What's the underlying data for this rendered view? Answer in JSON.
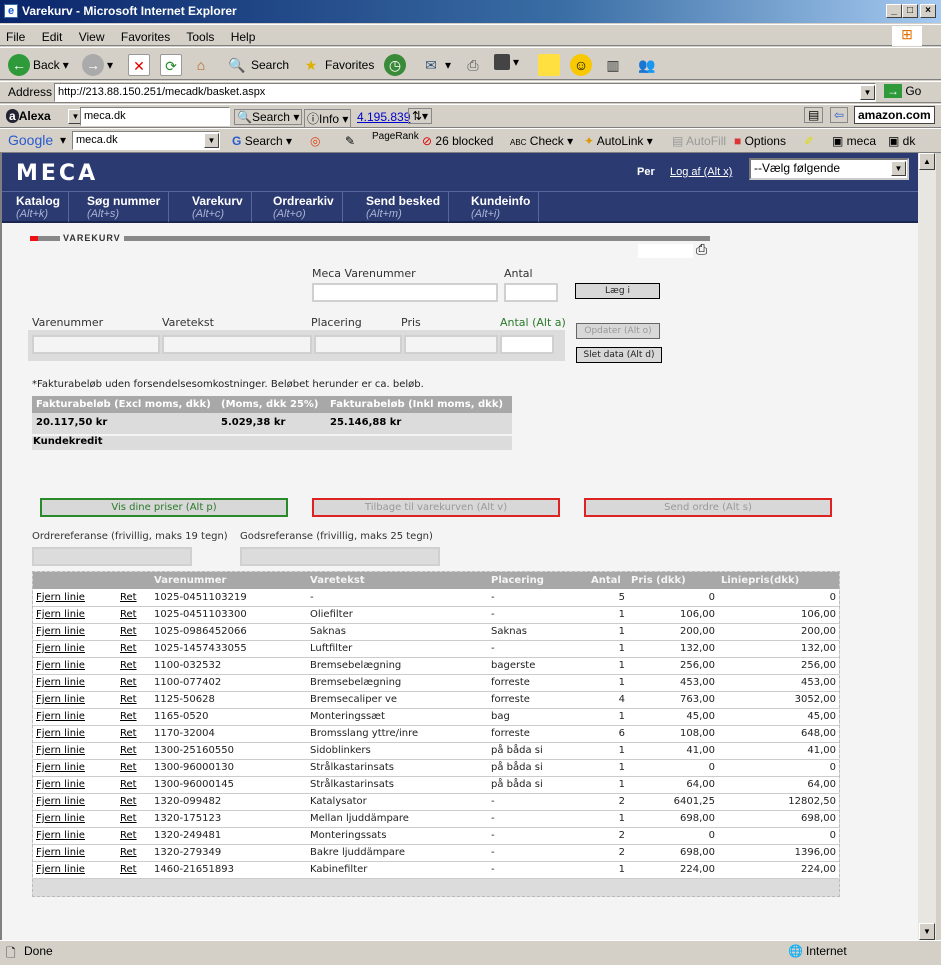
{
  "window": {
    "title": "Varekurv - Microsoft Internet Explorer"
  },
  "menu": [
    "File",
    "Edit",
    "View",
    "Favorites",
    "Tools",
    "Help"
  ],
  "toolbar": {
    "back": "Back",
    "search": "Search",
    "favorites": "Favorites"
  },
  "address": {
    "label": "Address",
    "url": "http://213.88.150.251/mecadk/basket.aspx",
    "go": "Go"
  },
  "alexa": {
    "brand": "Alexa",
    "query": "meca.dk",
    "search": "Search",
    "info": "Info",
    "rank": "4.195.839",
    "amazon": "amazon.com"
  },
  "google": {
    "brand": "Google",
    "query": "meca.dk",
    "search": "Search",
    "pagerank": "PageRank",
    "blocked": "26 blocked",
    "check": "Check",
    "autolink": "AutoLink",
    "autofill": "AutoFill",
    "options": "Options",
    "meca": "meca",
    "dk": "dk"
  },
  "header": {
    "logo": "MECA",
    "user": "Per",
    "logout": "Log af (Alt x)",
    "select": "--Vælg følgende"
  },
  "nav": [
    {
      "label": "Katalog",
      "key": "(Alt+k)"
    },
    {
      "label": "Søg nummer",
      "key": "(Alt+s)"
    },
    {
      "label": "Varekurv",
      "key": "(Alt+c)"
    },
    {
      "label": "Ordrearkiv",
      "key": "(Alt+o)"
    },
    {
      "label": "Send besked",
      "key": "(Alt+m)"
    },
    {
      "label": "Kundeinfo",
      "key": "(Alt+i)"
    }
  ],
  "section_title": "VAREKURV",
  "add": {
    "meca_varenummer": "Meca Varenummer",
    "antal": "Antal",
    "button": "Læg i"
  },
  "edit": {
    "varenummer": "Varenummer",
    "varetekst": "Varetekst",
    "placering": "Placering",
    "pris": "Pris",
    "antal": "Antal (Alt a)",
    "update": "Opdater (Alt o)",
    "delete": "Slet data (Alt d)"
  },
  "summary": {
    "note": "*Fakturabeløb uden forsendelsesomkostninger. Beløbet herunder er ca. beløb.",
    "headers": [
      "Fakturabeløb (Excl moms, dkk)",
      "(Moms, dkk 25%)",
      "Fakturabeløb (Inkl moms, dkk)"
    ],
    "values": [
      "20.117,50 kr",
      "5.029,38 kr",
      "25.146,88 kr"
    ],
    "credit": "Kundekredit"
  },
  "actions": {
    "prices": "Vis dine priser (Alt p)",
    "back": "Tilbage til varekurven  (Alt v)",
    "send": "Send ordre (Alt s)"
  },
  "refs": {
    "order": "Ordrereferanse (frivillig, maks 19 tegn)",
    "goods": "Godsreferanse (frivillig, maks 25 tegn)"
  },
  "cart": {
    "headers": [
      "",
      "",
      "Varenummer",
      "Varetekst",
      "Placering",
      "Antal",
      "Pris (dkk)",
      "Liniepris(dkk)"
    ],
    "remove": "Fjern linie",
    "edit": "Ret",
    "rows": [
      [
        "1025-0451103219",
        "-",
        "-",
        "5",
        "0",
        "0"
      ],
      [
        "1025-0451103300",
        "Oliefilter",
        "-",
        "1",
        "106,00",
        "106,00"
      ],
      [
        "1025-0986452066",
        "Saknas",
        "Saknas",
        "1",
        "200,00",
        "200,00"
      ],
      [
        "1025-1457433055",
        "Luftfilter",
        "-",
        "1",
        "132,00",
        "132,00"
      ],
      [
        "1100-032532",
        "Bremsebelægning",
        "bagerste",
        "1",
        "256,00",
        "256,00"
      ],
      [
        "1100-077402",
        "Bremsebelægning",
        "forreste",
        "1",
        "453,00",
        "453,00"
      ],
      [
        "1125-50628",
        "Bremsecaliper ve",
        "forreste",
        "4",
        "763,00",
        "3052,00"
      ],
      [
        "1165-0520",
        "Monteringssæt",
        "bag",
        "1",
        "45,00",
        "45,00"
      ],
      [
        "1170-32004",
        "Bromsslang yttre/inre",
        "forreste",
        "6",
        "108,00",
        "648,00"
      ],
      [
        "1300-25160550",
        "Sidoblinkers",
        "på båda si",
        "1",
        "41,00",
        "41,00"
      ],
      [
        "1300-96000130",
        "Strålkastarinsats",
        "på båda si",
        "1",
        "0",
        "0"
      ],
      [
        "1300-96000145",
        "Strålkastarinsats",
        "på båda si",
        "1",
        "64,00",
        "64,00"
      ],
      [
        "1320-099482",
        "Katalysator",
        "-",
        "2",
        "6401,25",
        "12802,50"
      ],
      [
        "1320-175123",
        "Mellan ljuddämpare",
        "-",
        "1",
        "698,00",
        "698,00"
      ],
      [
        "1320-249481",
        "Monteringssats",
        "-",
        "2",
        "0",
        "0"
      ],
      [
        "1320-279349",
        "Bakre ljuddämpare",
        "-",
        "2",
        "698,00",
        "1396,00"
      ],
      [
        "1460-21651893",
        "Kabinefilter",
        "-",
        "1",
        "224,00",
        "224,00"
      ]
    ]
  },
  "status": {
    "text": "Done",
    "zone": "Internet"
  }
}
